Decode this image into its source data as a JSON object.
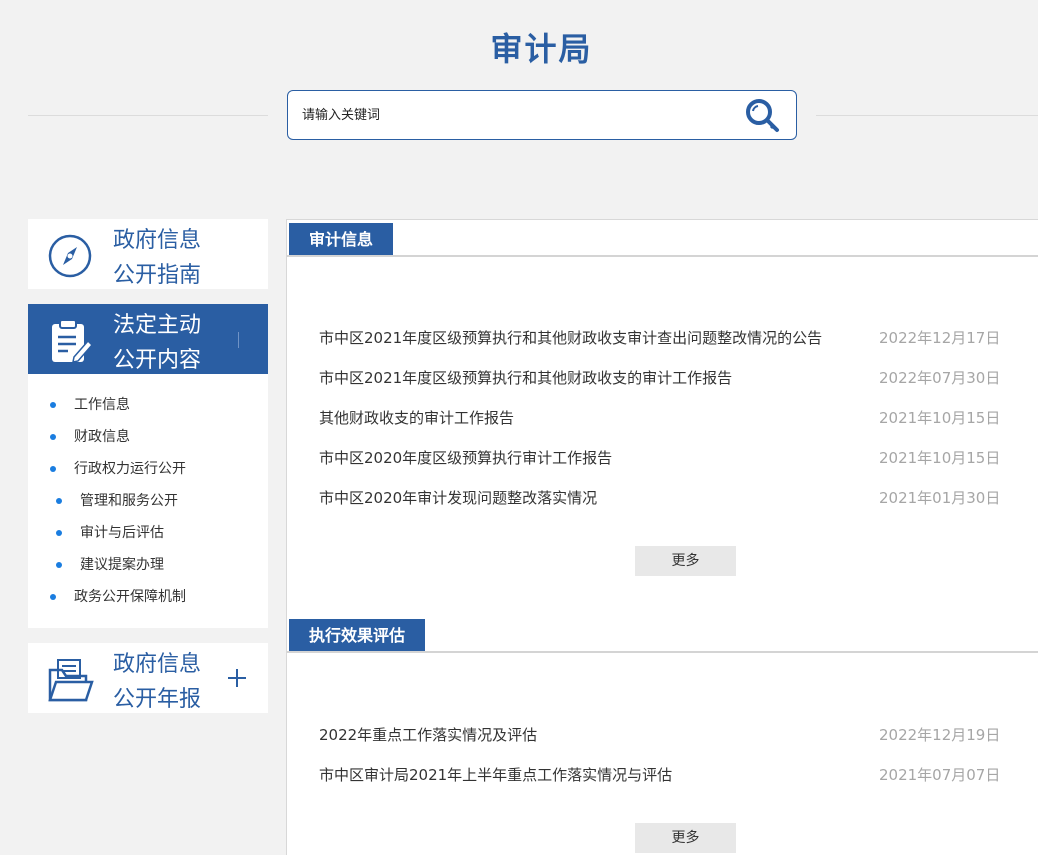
{
  "header": {
    "title": "审计局",
    "search_placeholder": "请输入关键词"
  },
  "sidebar": {
    "guide": {
      "line1": "政府信息",
      "line2": "公开指南"
    },
    "content": {
      "line1": "法定主动",
      "line2": "公开内容"
    },
    "items": [
      {
        "label": "工作信息"
      },
      {
        "label": "财政信息"
      },
      {
        "label": "行政权力运行公开"
      },
      {
        "label": "管理和服务公开"
      },
      {
        "label": "审计与后评估"
      },
      {
        "label": "建议提案办理"
      },
      {
        "label": "政务公开保障机制"
      }
    ],
    "report": {
      "line1": "政府信息",
      "line2": "公开年报"
    }
  },
  "sections": [
    {
      "title": "审计信息",
      "items": [
        {
          "title": "市中区2021年度区级预算执行和其他财政收支审计查出问题整改情况的公告",
          "date": "2022年12月17日"
        },
        {
          "title": "市中区2021年度区级预算执行和其他财政收支的审计工作报告",
          "date": "2022年07月30日"
        },
        {
          "title": "其他财政收支的审计工作报告",
          "date": "2021年10月15日"
        },
        {
          "title": "市中区2020年度区级预算执行审计工作报告",
          "date": "2021年10月15日"
        },
        {
          "title": "市中区2020年审计发现问题整改落实情况",
          "date": "2021年01月30日"
        }
      ],
      "more": "更多"
    },
    {
      "title": "执行效果评估",
      "items": [
        {
          "title": "2022年重点工作落实情况及评估",
          "date": "2022年12月19日"
        },
        {
          "title": "市中区审计局2021年上半年重点工作落实情况与评估",
          "date": "2021年07月07日"
        }
      ],
      "more": "更多"
    }
  ],
  "colors": {
    "brand": "#2a5ea3",
    "background": "#f2f2f2",
    "bullet": "#1a7de0",
    "date": "#a6a6a6"
  },
  "icons": {
    "search": "magnifier-key-icon",
    "guide": "compass-icon",
    "content": "clipboard-pen-icon",
    "report": "folder-documents-icon",
    "expand": "plus-icon"
  }
}
